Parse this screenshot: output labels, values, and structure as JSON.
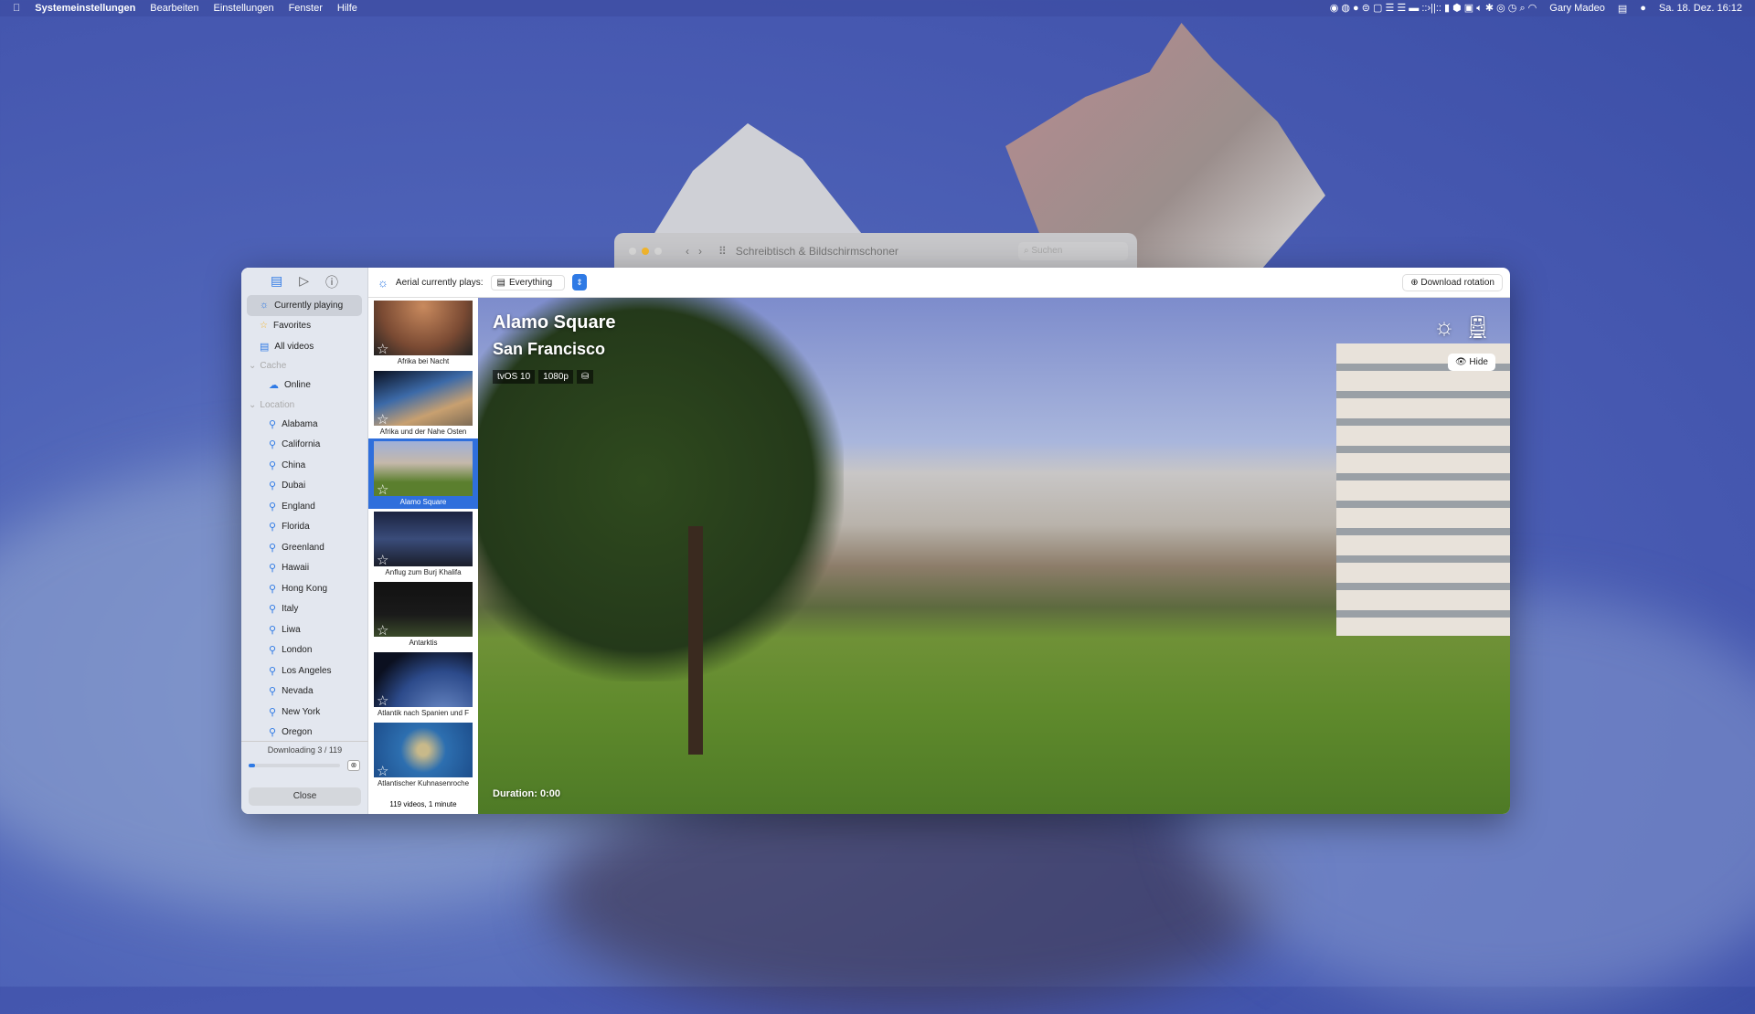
{
  "menubar": {
    "apple": "",
    "app": "Systemeinstellungen",
    "items": [
      "Bearbeiten",
      "Einstellungen",
      "Fenster",
      "Hilfe"
    ],
    "user": "Gary Madeo",
    "datetime": "Sa. 18. Dez.  16:12"
  },
  "bg_window": {
    "title": "Schreibtisch & Bildschirmschoner",
    "search_placeholder": "Suchen"
  },
  "sidebar": {
    "top": [
      {
        "label": "Currently playing",
        "icon": "sun-icon"
      },
      {
        "label": "Favorites",
        "icon": "star-icon"
      },
      {
        "label": "All videos",
        "icon": "film-icon"
      }
    ],
    "cache_group": "Cache",
    "cache_items": [
      "Online"
    ],
    "location_group": "Location",
    "locations": [
      "Alabama",
      "California",
      "China",
      "Dubai",
      "England",
      "Florida",
      "Greenland",
      "Hawaii",
      "Hong Kong",
      "Italy",
      "Liwa",
      "London",
      "Los Angeles",
      "Nevada",
      "New York",
      "Oregon"
    ],
    "downloading": "Downloading 3 / 119",
    "download_progress": 0.07,
    "close": "Close"
  },
  "topbar": {
    "label": "Aerial currently plays:",
    "selection": "Everything",
    "download_rotation": "Download rotation"
  },
  "thumbnails": [
    {
      "title": "Afrika bei Nacht"
    },
    {
      "title": "Afrika und der Nahe Osten"
    },
    {
      "title": "Alamo Square",
      "selected": true
    },
    {
      "title": "Anflug zum Burj Khalifa"
    },
    {
      "title": "Antarktis"
    },
    {
      "title": "Atlantik nach Spanien und F"
    },
    {
      "title": "Atlantischer Kuhnasenroche"
    }
  ],
  "thumb_count": "119 videos, 1 minute",
  "video": {
    "title": "Alamo Square",
    "subtitle": "San Francisco",
    "tags": [
      "tvOS 10",
      "1080p"
    ],
    "hide": "Hide",
    "duration": "Duration: 0:00"
  },
  "colors": {
    "accent": "#2f7ae5"
  }
}
